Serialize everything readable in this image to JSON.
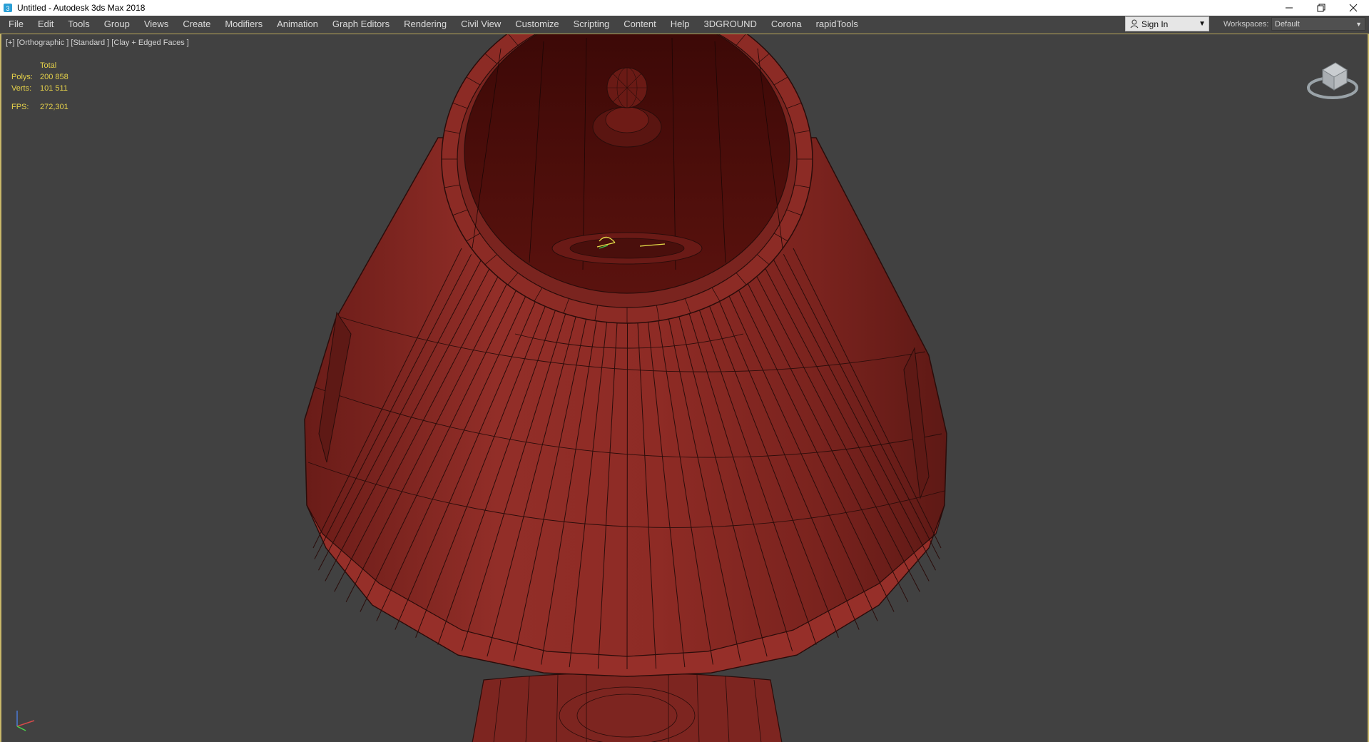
{
  "window": {
    "title": "Untitled - Autodesk 3ds Max 2018",
    "app_icon": "3dsmax-icon",
    "minimize_icon": "minimize-icon",
    "restore_icon": "restore-icon",
    "close_icon": "close-icon"
  },
  "menu": {
    "items": [
      "File",
      "Edit",
      "Tools",
      "Group",
      "Views",
      "Create",
      "Modifiers",
      "Animation",
      "Graph Editors",
      "Rendering",
      "Civil View",
      "Customize",
      "Scripting",
      "Content",
      "Help",
      "3DGROUND",
      "Corona",
      "rapidTools"
    ]
  },
  "signin": {
    "label": "Sign In",
    "icon": "user-icon"
  },
  "workspaces": {
    "label": "Workspaces:",
    "value": "Default"
  },
  "viewport": {
    "label": "[+] [Orthographic ] [Standard ] [Clay + Edged Faces ]",
    "stats": {
      "header": "Total",
      "polys_label": "Polys:",
      "polys_value": "200 858",
      "verts_label": "Verts:",
      "verts_value": "101 511",
      "fps_label": "FPS:",
      "fps_value": "272,301"
    }
  },
  "colors": {
    "viewport_bg": "#414141",
    "clay_red": "#8a2a24",
    "wire": "#2a0c0a",
    "stats_yellow": "#e6d24a",
    "active_border": "#c9b86a"
  }
}
